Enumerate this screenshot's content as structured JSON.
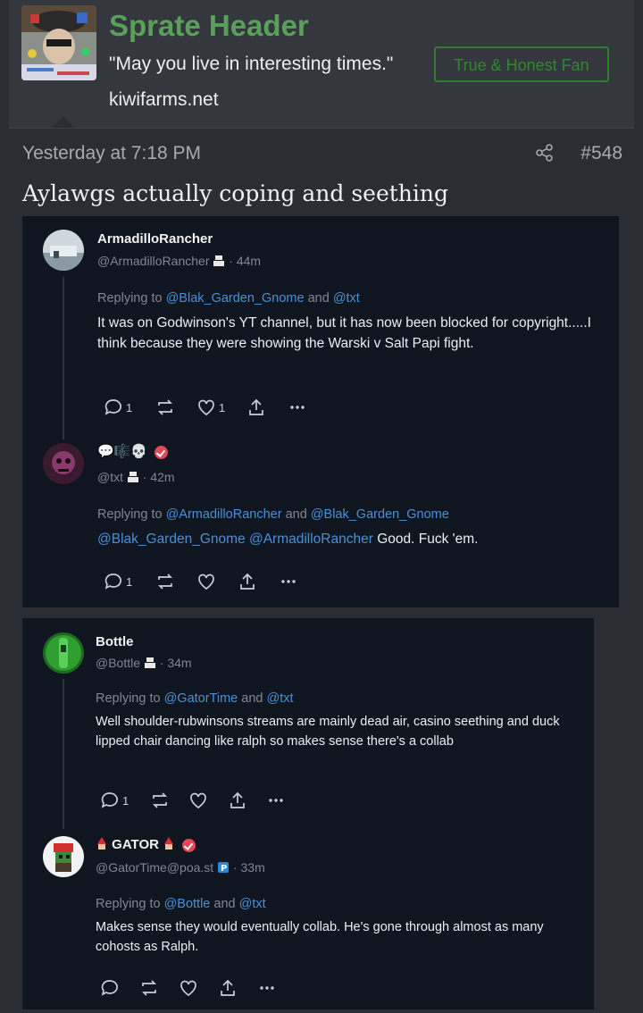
{
  "profile": {
    "username": "Sprate Header",
    "tagline": "\"May you live in interesting times.\"",
    "badge": "True & Honest Fan",
    "site": "kiwifarms.net"
  },
  "post": {
    "timestamp": "Yesterday at 7:18 PM",
    "number": "#548",
    "text": "Aylawgs actually coping and seething"
  },
  "tweets_card1": [
    {
      "name": "ArmadilloRancher",
      "handle": "@ArmadilloRancher",
      "age": "· 44m",
      "replying_prefix": "Replying to",
      "replying_1": "@Blak_Garden_Gnome",
      "replying_and": "and",
      "replying_2": "@txt",
      "body": "It was on Godwinson's YT channel, but it has now been blocked for copyright.....I think because they were showing the Warski v Salt Papi fight.",
      "replies": "1",
      "likes": "1"
    },
    {
      "name": "💬🎼💀",
      "handle": "@txt",
      "age": "· 42m",
      "replying_prefix": "Replying to",
      "replying_1": "@ArmadilloRancher",
      "replying_and": "and",
      "replying_2": "@Blak_Garden_Gnome",
      "body_mentions": "@Blak_Garden_Gnome @ArmadilloRancher",
      "body": " Good. Fuck 'em.",
      "replies": "1"
    }
  ],
  "tweets_card2": [
    {
      "name": "Bottle",
      "handle": "@Bottle",
      "age": "· 34m",
      "replying_prefix": "Replying to",
      "replying_1": "@GatorTime",
      "replying_and": "and",
      "replying_2": "@txt",
      "body": "Well shoulder-rubwinsons streams are mainly dead air, casino seething and duck lipped chair dancing like ralph so makes sense there's a collab",
      "replies": "1"
    },
    {
      "name": "GATOR",
      "handle": "@GatorTime@poa.st",
      "age": "· 33m",
      "replying_prefix": "Replying to",
      "replying_1": "@Bottle",
      "replying_and": "and",
      "replying_2": "@txt",
      "body": "Makes sense they would eventually collab. He's gone through almost as many cohosts as Ralph."
    }
  ],
  "colors": {
    "accent_green": "#5aa05a",
    "mention_blue": "#4a90d9",
    "verified_red": "#e0485a",
    "card_bg": "#0f1620"
  },
  "icons": [
    "share-icon",
    "reply-icon",
    "retweet-icon",
    "like-icon",
    "upload-icon",
    "more-icon",
    "verified-icon"
  ]
}
